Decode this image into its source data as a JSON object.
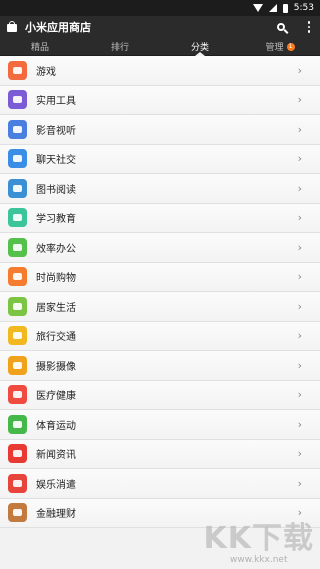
{
  "status_bar": {
    "time": "5:53",
    "icons": [
      "wifi-icon",
      "signal-icon",
      "battery-icon"
    ]
  },
  "app_bar": {
    "title": "小米应用商店",
    "logo_icon": "store-bag-icon",
    "search_icon": "search-icon",
    "menu_icon": "more-vertical-icon"
  },
  "tabs": [
    {
      "label": "精品",
      "active": false
    },
    {
      "label": "排行",
      "active": false
    },
    {
      "label": "分类",
      "active": true
    },
    {
      "label": "管理",
      "active": false,
      "badge": "1"
    }
  ],
  "categories": [
    {
      "label": "游戏",
      "icon": "gamepad-icon",
      "color": "#f26a3d"
    },
    {
      "label": "实用工具",
      "icon": "wrench-icon",
      "color": "#7b5cd6"
    },
    {
      "label": "影音视听",
      "icon": "headphones-icon",
      "color": "#4a7fe0"
    },
    {
      "label": "聊天社交",
      "icon": "chat-bubble-icon",
      "color": "#3a8ee6"
    },
    {
      "label": "图书阅读",
      "icon": "book-icon",
      "color": "#3b8fd4"
    },
    {
      "label": "学习教育",
      "icon": "flask-icon",
      "color": "#3cc59b"
    },
    {
      "label": "效率办公",
      "icon": "folder-icon",
      "color": "#55c14a"
    },
    {
      "label": "时尚购物",
      "icon": "shopping-bag-icon",
      "color": "#f57b2e"
    },
    {
      "label": "居家生活",
      "icon": "paper-plane-icon",
      "color": "#7cc443"
    },
    {
      "label": "旅行交通",
      "icon": "suitcase-icon",
      "color": "#f2b81f"
    },
    {
      "label": "摄影摄像",
      "icon": "video-camera-icon",
      "color": "#f0a21a"
    },
    {
      "label": "医疗健康",
      "icon": "heart-icon",
      "color": "#ef4b3f"
    },
    {
      "label": "体育运动",
      "icon": "whistle-icon",
      "color": "#46b84a"
    },
    {
      "label": "新闻资讯",
      "icon": "newspaper-icon",
      "color": "#e83a32"
    },
    {
      "label": "娱乐消遣",
      "icon": "microphone-icon",
      "color": "#e7453c"
    },
    {
      "label": "金融理财",
      "icon": "dollar-icon",
      "color": "#c27a3f"
    }
  ],
  "chevron": "›",
  "watermark": {
    "brand": "KK下载",
    "url": "www.kkx.net"
  }
}
